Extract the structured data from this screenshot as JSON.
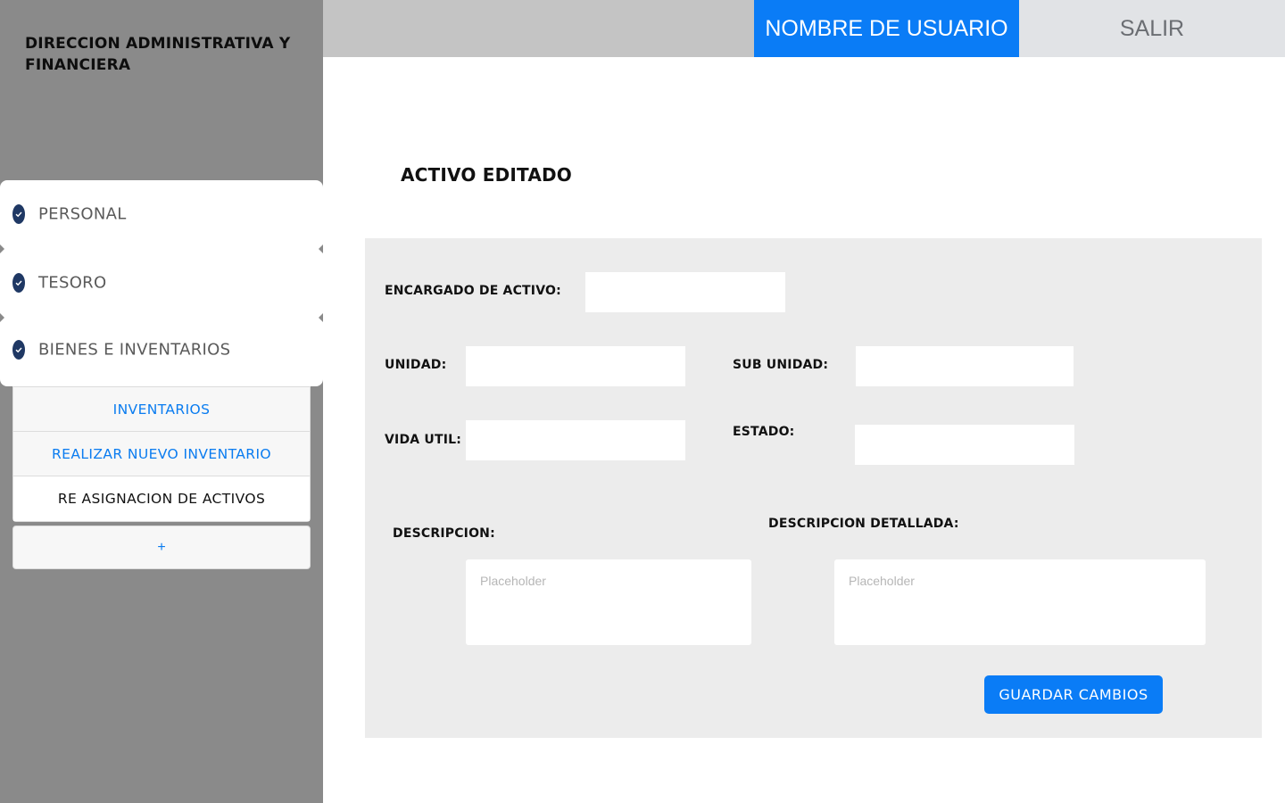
{
  "sidebar": {
    "org_title_line1": "DIRECCION ADMINISTRATIVA Y",
    "org_title_line2": "FINANCIERA",
    "accordion": [
      {
        "label": "PERSONAL"
      },
      {
        "label": "TESORO"
      },
      {
        "label": "BIENES E INVENTARIOS"
      }
    ],
    "submenu": [
      {
        "label": "INVENTARIOS"
      },
      {
        "label": "REALIZAR NUEVO INVENTARIO"
      },
      {
        "label": "RE ASIGNACION DE ACTIVOS"
      }
    ],
    "add_label": "+"
  },
  "topbar": {
    "user_label": "NOMBRE DE USUARIO",
    "logout_label": "SALIR"
  },
  "main": {
    "title": "ACTIVO EDITADO",
    "form": {
      "encargado_label": "ENCARGADO DE ACTIVO:",
      "encargado_value": "",
      "unidad_label": "UNIDAD:",
      "unidad_value": "",
      "sub_unidad_label": "SUB UNIDAD:",
      "sub_unidad_value": "",
      "vida_util_label": "VIDA UTIL:",
      "vida_util_value": "",
      "estado_label": "ESTADO:",
      "estado_value": "",
      "descripcion_label": "DESCRIPCION:",
      "descripcion_placeholder": "Placeholder",
      "descripcion_detallada_label": "DESCRIPCION DETALLADA:",
      "descripcion_detallada_placeholder": "Placeholder",
      "save_label": "GUARDAR CAMBIOS"
    }
  },
  "colors": {
    "primary": "#0a7cf6",
    "sidebar_bg": "#8a8a8a",
    "check_icon": "#1f3864",
    "panel_bg": "#ececec"
  },
  "icons": {
    "accordion_icon": "check-circle-icon"
  }
}
